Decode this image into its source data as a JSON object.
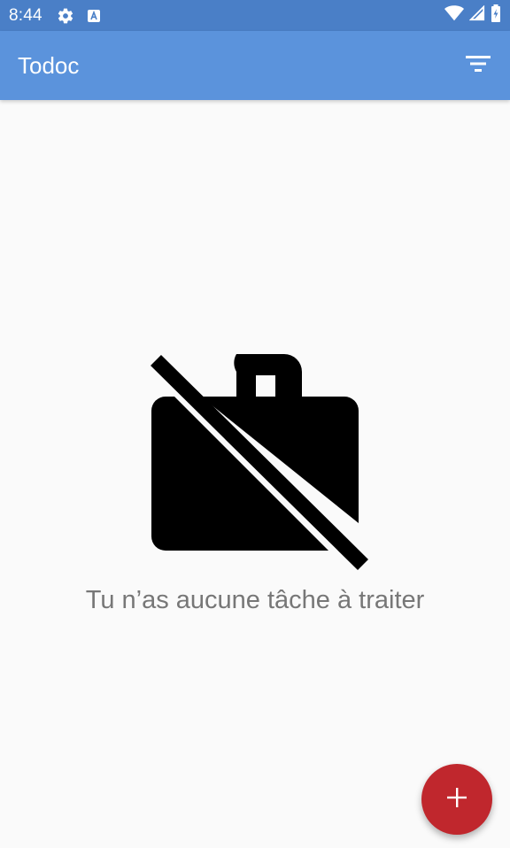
{
  "status_bar": {
    "time": "8:44",
    "icons": [
      "settings-icon",
      "a-badge-icon",
      "wifi-icon",
      "signal-icon",
      "battery-icon"
    ]
  },
  "app_bar": {
    "title": "Todoc",
    "actions": [
      "filter-icon"
    ]
  },
  "empty_state": {
    "icon": "work-off-icon",
    "message": "Tu n’as aucune tâche à traiter"
  },
  "fab": {
    "icon": "add-icon"
  },
  "colors": {
    "status_bar": "#4a7fc7",
    "app_bar": "#5b93dc",
    "fab": "#c0272d",
    "background": "#fafafa",
    "message_text": "#777777"
  }
}
